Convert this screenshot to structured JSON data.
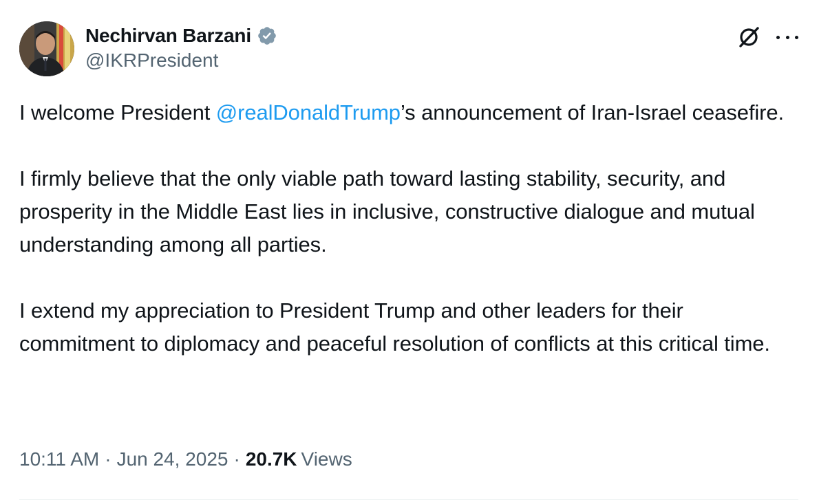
{
  "author": {
    "display_name": "Nechirvan Barzani",
    "handle": "@IKRPresident",
    "verified": true,
    "verified_badge_color": "#829aab"
  },
  "icons": {
    "grok": "grok-slash-icon",
    "more": "more-horizontal-icon",
    "verified": "verified-badge-icon"
  },
  "tweet": {
    "para1_before": "I welcome President ",
    "para1_mention": "@realDonaldTrump",
    "para1_after": "’s announcement of Iran-Israel ceasefire.",
    "para2": "I firmly believe that the only viable path toward lasting stability, security, and prosperity in the Middle East lies in inclusive, constructive dialogue and mutual understanding among all parties.",
    "para3": "I extend my appreciation to President Trump and other leaders for their commitment to diplomacy and peaceful resolution of conflicts at this critical time."
  },
  "meta": {
    "time": "10:11 AM",
    "separator": "·",
    "date": "Jun 24, 2025",
    "views_count": "20.7K",
    "views_label": "Views"
  },
  "colors": {
    "text": "#0f1419",
    "secondary": "#536471",
    "link": "#1d9bf0",
    "divider": "#eff3f4"
  }
}
